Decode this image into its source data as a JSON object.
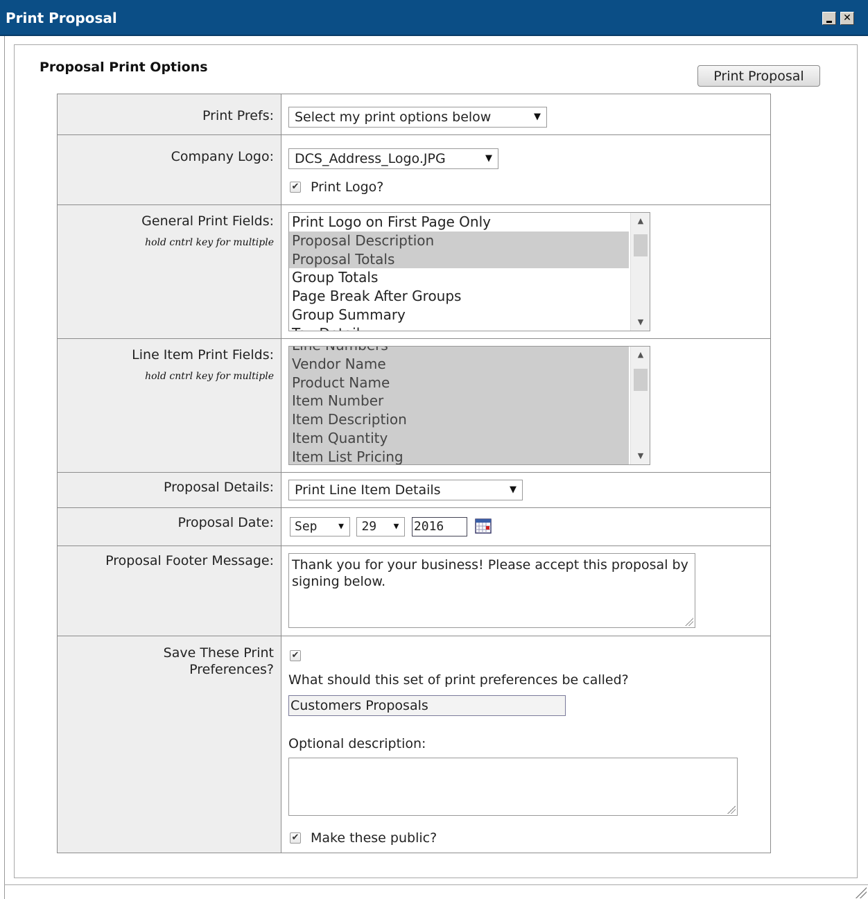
{
  "window": {
    "title": "Print Proposal",
    "min_glyph": "",
    "close_glyph": "✕"
  },
  "section_title": "Proposal Print Options",
  "print_button": "Print Proposal",
  "rows": {
    "print_prefs": {
      "label": "Print Prefs:",
      "value": "Select my print options below"
    },
    "company_logo": {
      "label": "Company Logo:",
      "value": "DCS_Address_Logo.JPG",
      "print_logo_label": "Print Logo?",
      "print_logo_checked": true
    },
    "general_fields": {
      "label": "General Print Fields:",
      "hint": "hold cntrl key for multiple",
      "items": [
        {
          "text": "Print Logo on First Page Only",
          "selected": false
        },
        {
          "text": "Proposal Description",
          "selected": true
        },
        {
          "text": "Proposal Totals",
          "selected": true
        },
        {
          "text": "Group Totals",
          "selected": false
        },
        {
          "text": "Page Break After Groups",
          "selected": false
        },
        {
          "text": "Group Summary",
          "selected": false
        },
        {
          "text": "Tax Detail",
          "selected": false
        }
      ]
    },
    "line_item_fields": {
      "label": "Line Item Print Fields:",
      "hint": "hold cntrl key for multiple",
      "items": [
        {
          "text": "Line Numbers",
          "selected": true
        },
        {
          "text": "Vendor Name",
          "selected": true
        },
        {
          "text": "Product Name",
          "selected": true
        },
        {
          "text": "Item Number",
          "selected": true
        },
        {
          "text": "Item Description",
          "selected": true
        },
        {
          "text": "Item Quantity",
          "selected": true
        },
        {
          "text": "Item List Pricing",
          "selected": true
        }
      ]
    },
    "proposal_details": {
      "label": "Proposal Details:",
      "value": "Print Line Item Details"
    },
    "proposal_date": {
      "label": "Proposal Date:",
      "month": "Sep",
      "day": "29",
      "year": "2016"
    },
    "footer_message": {
      "label": "Proposal Footer Message:",
      "value": "Thank you for your business! Please accept this proposal by signing below."
    },
    "save_prefs": {
      "label": "Save These Print Preferences?",
      "checked": true,
      "name_prompt": "What should this set of print preferences be called?",
      "name_value": "Customers Proposals",
      "description_label": "Optional description:",
      "description_value": "",
      "public_label": "Make these public?",
      "public_checked": true
    }
  },
  "colors": {
    "titlebar": "#0b4e86",
    "label_bg": "#eeeeee",
    "selected_item": "#cdcdcd"
  }
}
